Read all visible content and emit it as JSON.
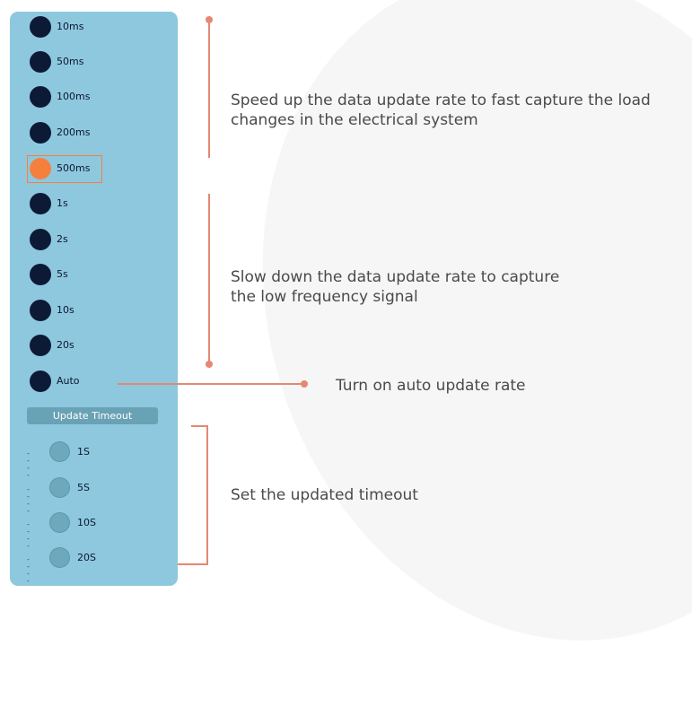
{
  "update_rates": [
    {
      "label": "10ms",
      "selected": false
    },
    {
      "label": "50ms",
      "selected": false
    },
    {
      "label": "100ms",
      "selected": false
    },
    {
      "label": "200ms",
      "selected": false
    },
    {
      "label": "500ms",
      "selected": true
    },
    {
      "label": "1s",
      "selected": false
    },
    {
      "label": "2s",
      "selected": false
    },
    {
      "label": "5s",
      "selected": false
    },
    {
      "label": "10s",
      "selected": false
    },
    {
      "label": "20s",
      "selected": false
    },
    {
      "label": "Auto",
      "selected": false
    }
  ],
  "timeout": {
    "header": "Update Timeout",
    "dash": "----",
    "options": [
      "1S",
      "5S",
      "10S",
      "20S"
    ]
  },
  "notes": {
    "speed_up_line1": "Speed up the data update rate to fast capture the load",
    "speed_up_line2": "changes in the electrical system",
    "slow_down_line1": "Slow down the data update rate to capture",
    "slow_down_line2": "the low frequency signal",
    "auto": "Turn on auto update rate",
    "timeout": "Set the updated timeout"
  },
  "colors": {
    "panel": "#8ec8de",
    "dot": "#0c1a36",
    "selected": "#f5803e",
    "annotation": "#e58872"
  }
}
